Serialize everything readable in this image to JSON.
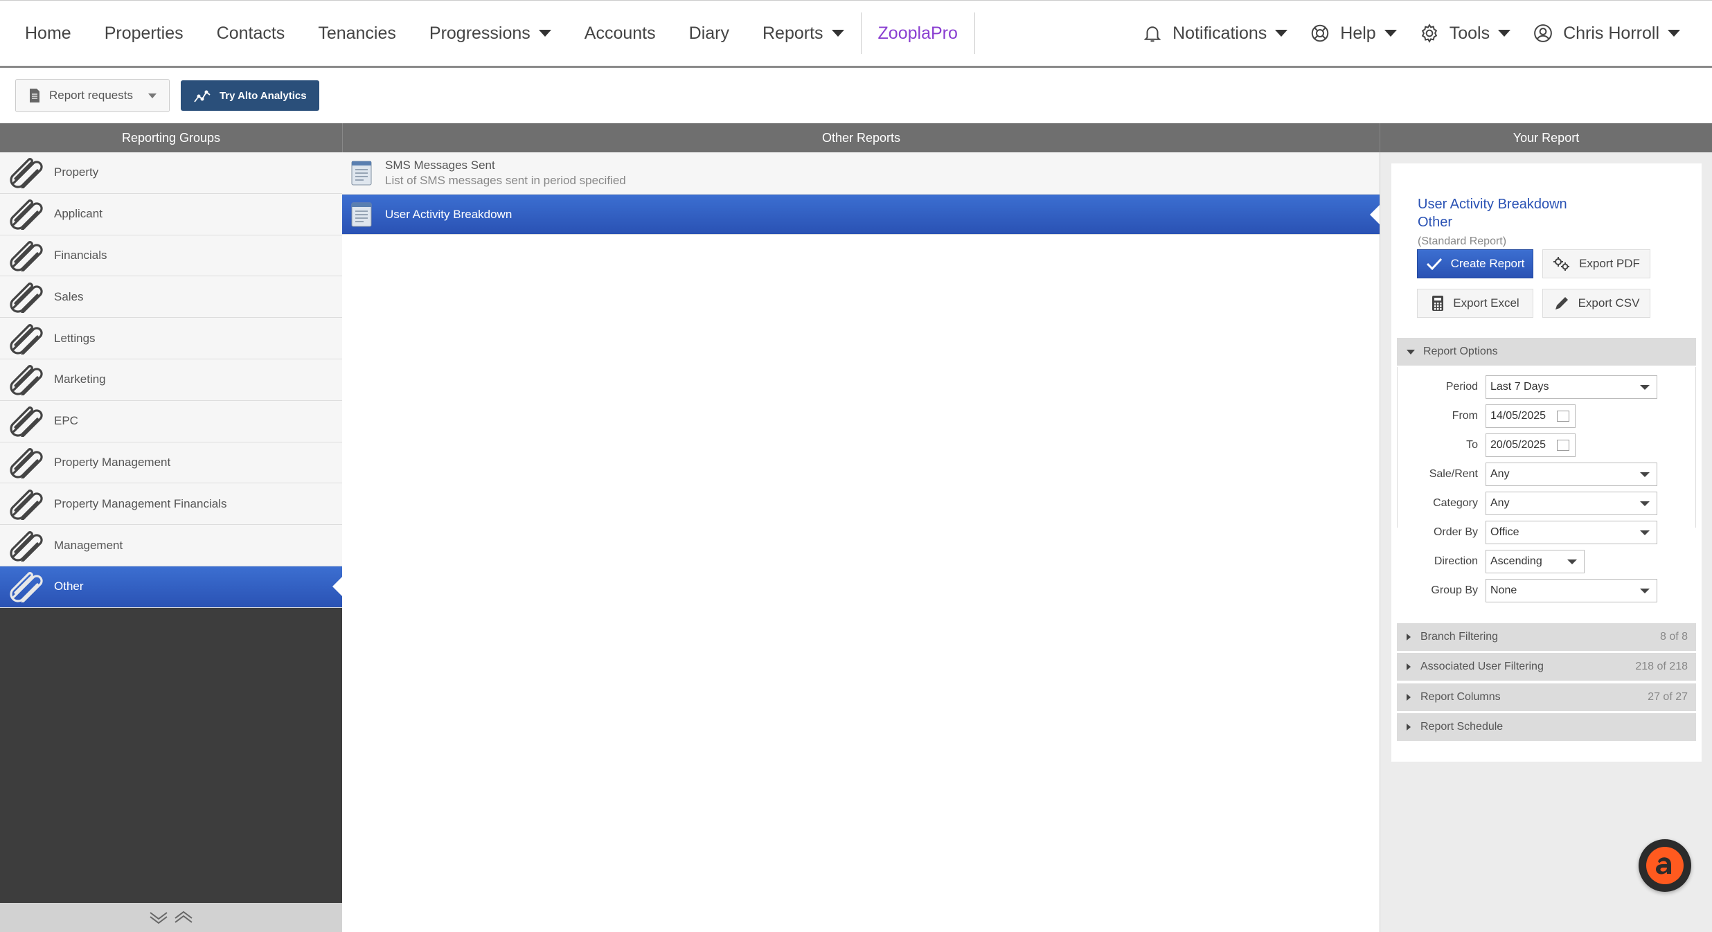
{
  "nav": {
    "items": [
      {
        "label": "Home",
        "dropdown": false
      },
      {
        "label": "Properties",
        "dropdown": false
      },
      {
        "label": "Contacts",
        "dropdown": false
      },
      {
        "label": "Tenancies",
        "dropdown": false
      },
      {
        "label": "Progressions",
        "dropdown": true
      },
      {
        "label": "Accounts",
        "dropdown": false
      },
      {
        "label": "Diary",
        "dropdown": false
      },
      {
        "label": "Reports",
        "dropdown": true
      }
    ],
    "zoopla": "ZooplaPro",
    "notifications": "Notifications",
    "help": "Help",
    "tools": "Tools",
    "user": "Chris Horroll"
  },
  "toolbar": {
    "requests": "Report requests",
    "analytics": "Try Alto Analytics"
  },
  "columns": {
    "left": "Reporting Groups",
    "middle": "Other Reports",
    "right": "Your Report"
  },
  "groups": [
    {
      "label": "Property",
      "active": false
    },
    {
      "label": "Applicant",
      "active": false
    },
    {
      "label": "Financials",
      "active": false
    },
    {
      "label": "Sales",
      "active": false
    },
    {
      "label": "Lettings",
      "active": false
    },
    {
      "label": "Marketing",
      "active": false
    },
    {
      "label": "EPC",
      "active": false
    },
    {
      "label": "Property Management",
      "active": false
    },
    {
      "label": "Property Management Financials",
      "active": false
    },
    {
      "label": "Management",
      "active": false
    },
    {
      "label": "Other",
      "active": true
    }
  ],
  "reports": [
    {
      "title": "SMS Messages Sent",
      "desc": "List of SMS messages sent in period specified",
      "active": false
    },
    {
      "title": "User Activity Breakdown",
      "desc": "",
      "active": true
    }
  ],
  "your_report": {
    "title": "User Activity Breakdown",
    "group": "Other",
    "kind": "(Standard Report)",
    "create": "Create Report",
    "export_pdf": "Export PDF",
    "export_excel": "Export Excel",
    "export_csv": "Export CSV",
    "options_header": "Report Options",
    "options": {
      "period_label": "Period",
      "period": "Last 7 Days",
      "from_label": "From",
      "from": "14/05/2025",
      "to_label": "To",
      "to": "20/05/2025",
      "salerent_label": "Sale/Rent",
      "salerent": "Any",
      "category_label": "Category",
      "category": "Any",
      "orderby_label": "Order By",
      "orderby": "Office",
      "direction_label": "Direction",
      "direction": "Ascending",
      "groupby_label": "Group By",
      "groupby": "None"
    },
    "sections": [
      {
        "label": "Branch Filtering",
        "count": "8 of 8"
      },
      {
        "label": "Associated User Filtering",
        "count": "218 of 218"
      },
      {
        "label": "Report Columns",
        "count": "27 of 27"
      },
      {
        "label": "Report Schedule",
        "count": ""
      }
    ]
  },
  "colors": {
    "accent": "#2a52b4",
    "zoopla": "#8a3fd1",
    "alto": "#ff5a1f"
  }
}
